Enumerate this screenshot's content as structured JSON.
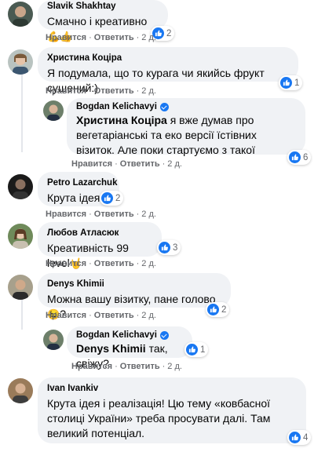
{
  "comments": [
    {
      "author": "Slavik Shakhtay",
      "text": "Смачно і креативно",
      "emoji": "💪👍",
      "reactions": "2",
      "like": "Нравится",
      "reply": "Ответить",
      "time": "2 д."
    },
    {
      "author": "Христина Коціра",
      "text": "Я подумала, що то курага чи якийсь фрукт сушений:)",
      "reactions": "1",
      "like": "Нравится",
      "reply": "Ответить",
      "time": "2 д."
    },
    {
      "author": "Bogdan Kelichavyi",
      "verified": true,
      "mention": "Христина Коціра",
      "text": " я вже думав про вегетаріанські та еко версії їстівних візиток. Але поки стартуємо з такої",
      "reactions": "6",
      "like": "Нравится",
      "reply": "Ответить",
      "time": "2 д."
    },
    {
      "author": "Petro Lazarchuk",
      "text": "Крута ідея!",
      "reactions": "2",
      "like": "Нравится",
      "reply": "Ответить",
      "time": "2 д."
    },
    {
      "author": "Любов Атласюк",
      "text": "Креативність 99 level",
      "emoji": "🤘",
      "reactions": "3",
      "like": "Нравится",
      "reply": "Ответить",
      "time": "2 д."
    },
    {
      "author": "Denys Khimii",
      "text": "Можна вашу візитку, пане голово",
      "emoji": "😉",
      "text_end": "?",
      "reactions": "2",
      "like": "Нравится",
      "reply": "Ответить",
      "time": "2 д."
    },
    {
      "author": "Bogdan Kelichavyi",
      "verified": true,
      "mention": "Denys Khimii",
      "text": " так, свіжу?",
      "reactions": "1",
      "like": "Нравится",
      "reply": "Ответить",
      "time": "2 д."
    },
    {
      "author": "Ivan Ivankiv",
      "text": "Крута ідея і реалізація! Цю тему «ковбасної столиці України» треба просувати далі. Там великий потенціал.",
      "reactions": "4",
      "like": "Нравится",
      "reply": "Ответить",
      "time": "2 д."
    }
  ],
  "colors": {
    "bubble": "#f0f2f5",
    "like": "#1877f2",
    "meta": "#65676b"
  }
}
